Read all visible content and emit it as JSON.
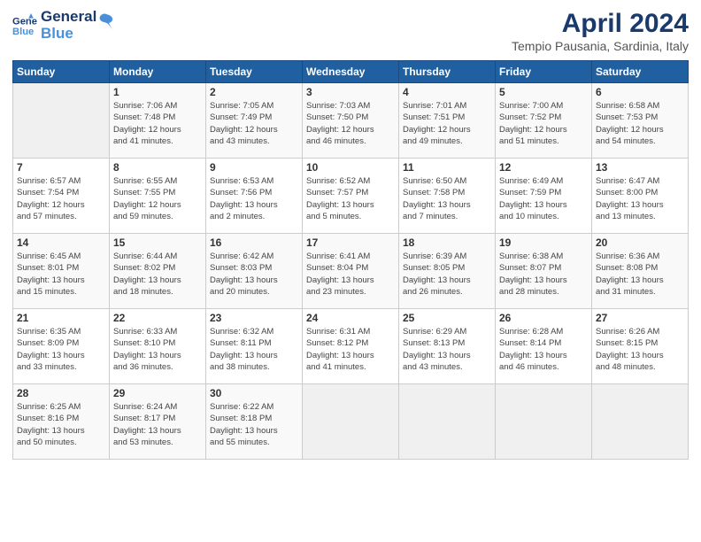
{
  "header": {
    "logo_line1": "General",
    "logo_line2": "Blue",
    "title": "April 2024",
    "subtitle": "Tempio Pausania, Sardinia, Italy"
  },
  "weekdays": [
    "Sunday",
    "Monday",
    "Tuesday",
    "Wednesday",
    "Thursday",
    "Friday",
    "Saturday"
  ],
  "weeks": [
    [
      {
        "day": "",
        "info": ""
      },
      {
        "day": "1",
        "info": "Sunrise: 7:06 AM\nSunset: 7:48 PM\nDaylight: 12 hours\nand 41 minutes."
      },
      {
        "day": "2",
        "info": "Sunrise: 7:05 AM\nSunset: 7:49 PM\nDaylight: 12 hours\nand 43 minutes."
      },
      {
        "day": "3",
        "info": "Sunrise: 7:03 AM\nSunset: 7:50 PM\nDaylight: 12 hours\nand 46 minutes."
      },
      {
        "day": "4",
        "info": "Sunrise: 7:01 AM\nSunset: 7:51 PM\nDaylight: 12 hours\nand 49 minutes."
      },
      {
        "day": "5",
        "info": "Sunrise: 7:00 AM\nSunset: 7:52 PM\nDaylight: 12 hours\nand 51 minutes."
      },
      {
        "day": "6",
        "info": "Sunrise: 6:58 AM\nSunset: 7:53 PM\nDaylight: 12 hours\nand 54 minutes."
      }
    ],
    [
      {
        "day": "7",
        "info": "Sunrise: 6:57 AM\nSunset: 7:54 PM\nDaylight: 12 hours\nand 57 minutes."
      },
      {
        "day": "8",
        "info": "Sunrise: 6:55 AM\nSunset: 7:55 PM\nDaylight: 12 hours\nand 59 minutes."
      },
      {
        "day": "9",
        "info": "Sunrise: 6:53 AM\nSunset: 7:56 PM\nDaylight: 13 hours\nand 2 minutes."
      },
      {
        "day": "10",
        "info": "Sunrise: 6:52 AM\nSunset: 7:57 PM\nDaylight: 13 hours\nand 5 minutes."
      },
      {
        "day": "11",
        "info": "Sunrise: 6:50 AM\nSunset: 7:58 PM\nDaylight: 13 hours\nand 7 minutes."
      },
      {
        "day": "12",
        "info": "Sunrise: 6:49 AM\nSunset: 7:59 PM\nDaylight: 13 hours\nand 10 minutes."
      },
      {
        "day": "13",
        "info": "Sunrise: 6:47 AM\nSunset: 8:00 PM\nDaylight: 13 hours\nand 13 minutes."
      }
    ],
    [
      {
        "day": "14",
        "info": "Sunrise: 6:45 AM\nSunset: 8:01 PM\nDaylight: 13 hours\nand 15 minutes."
      },
      {
        "day": "15",
        "info": "Sunrise: 6:44 AM\nSunset: 8:02 PM\nDaylight: 13 hours\nand 18 minutes."
      },
      {
        "day": "16",
        "info": "Sunrise: 6:42 AM\nSunset: 8:03 PM\nDaylight: 13 hours\nand 20 minutes."
      },
      {
        "day": "17",
        "info": "Sunrise: 6:41 AM\nSunset: 8:04 PM\nDaylight: 13 hours\nand 23 minutes."
      },
      {
        "day": "18",
        "info": "Sunrise: 6:39 AM\nSunset: 8:05 PM\nDaylight: 13 hours\nand 26 minutes."
      },
      {
        "day": "19",
        "info": "Sunrise: 6:38 AM\nSunset: 8:07 PM\nDaylight: 13 hours\nand 28 minutes."
      },
      {
        "day": "20",
        "info": "Sunrise: 6:36 AM\nSunset: 8:08 PM\nDaylight: 13 hours\nand 31 minutes."
      }
    ],
    [
      {
        "day": "21",
        "info": "Sunrise: 6:35 AM\nSunset: 8:09 PM\nDaylight: 13 hours\nand 33 minutes."
      },
      {
        "day": "22",
        "info": "Sunrise: 6:33 AM\nSunset: 8:10 PM\nDaylight: 13 hours\nand 36 minutes."
      },
      {
        "day": "23",
        "info": "Sunrise: 6:32 AM\nSunset: 8:11 PM\nDaylight: 13 hours\nand 38 minutes."
      },
      {
        "day": "24",
        "info": "Sunrise: 6:31 AM\nSunset: 8:12 PM\nDaylight: 13 hours\nand 41 minutes."
      },
      {
        "day": "25",
        "info": "Sunrise: 6:29 AM\nSunset: 8:13 PM\nDaylight: 13 hours\nand 43 minutes."
      },
      {
        "day": "26",
        "info": "Sunrise: 6:28 AM\nSunset: 8:14 PM\nDaylight: 13 hours\nand 46 minutes."
      },
      {
        "day": "27",
        "info": "Sunrise: 6:26 AM\nSunset: 8:15 PM\nDaylight: 13 hours\nand 48 minutes."
      }
    ],
    [
      {
        "day": "28",
        "info": "Sunrise: 6:25 AM\nSunset: 8:16 PM\nDaylight: 13 hours\nand 50 minutes."
      },
      {
        "day": "29",
        "info": "Sunrise: 6:24 AM\nSunset: 8:17 PM\nDaylight: 13 hours\nand 53 minutes."
      },
      {
        "day": "30",
        "info": "Sunrise: 6:22 AM\nSunset: 8:18 PM\nDaylight: 13 hours\nand 55 minutes."
      },
      {
        "day": "",
        "info": ""
      },
      {
        "day": "",
        "info": ""
      },
      {
        "day": "",
        "info": ""
      },
      {
        "day": "",
        "info": ""
      }
    ]
  ]
}
